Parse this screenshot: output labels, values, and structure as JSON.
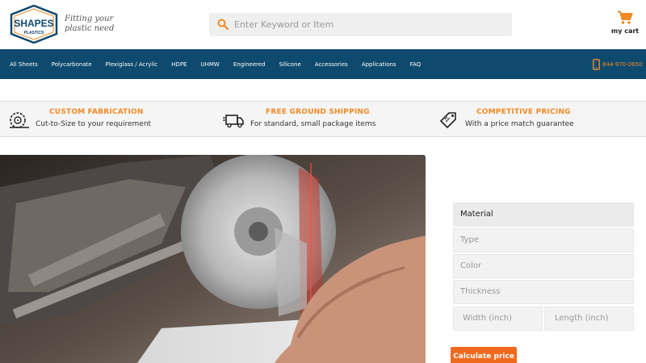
{
  "header": {
    "logo_text_top": "SHAPES",
    "logo_text_bottom": "PLASTICS",
    "tagline_line1": "Fitting your",
    "tagline_line2": "plastic need",
    "search_placeholder": "Enter Keyword or Item",
    "cart_label": "my cart"
  },
  "nav": {
    "items": [
      "All Sheets",
      "Polycarbonate",
      "Plexiglass / Acrylic",
      "HDPE",
      "UHMW",
      "Engineered",
      "Silicone",
      "Accessories",
      "Applications",
      "FAQ"
    ],
    "phone": "844-970-0650"
  },
  "features": [
    {
      "icon": "saw-blade-icon",
      "title": "CUSTOM FABRICATION",
      "subtitle": "Cut-to-Size to your requirement"
    },
    {
      "icon": "delivery-truck-icon",
      "title": "FREE GROUND SHIPPING",
      "subtitle": "For standard, small package items"
    },
    {
      "icon": "price-tag-icon",
      "title": "COMPETITIVE PRICING",
      "subtitle": "With a price match guarantee"
    }
  ],
  "form": {
    "material": "Material",
    "type": "Type",
    "color": "Color",
    "thickness": "Thickness",
    "width": "Width (inch)",
    "length": "Length (inch)",
    "submit": "Calculate price"
  },
  "colors": {
    "nav_bg": "#0d4a6e",
    "accent": "#f08a24",
    "button": "#f06a1e"
  }
}
